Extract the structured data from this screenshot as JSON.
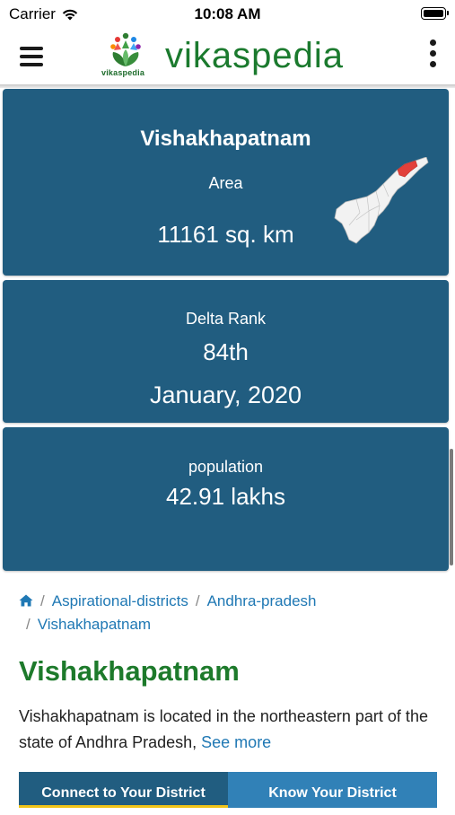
{
  "status_bar": {
    "carrier": "Carrier",
    "time": "10:08 AM"
  },
  "header": {
    "logo_text": "vikaspedia",
    "logo_small_text": "vikaspedia",
    "menu_icon": "hamburger-menu-icon",
    "more_icon": "vertical-ellipsis-icon"
  },
  "stats": {
    "district_name": "Vishakhapatnam",
    "area_label": "Area",
    "area_value": "11161 sq. km",
    "delta_rank_label": "Delta Rank",
    "delta_rank_value": "84th",
    "delta_rank_date": "January, 2020",
    "population_label": "population",
    "population_value": "42.91 lakhs"
  },
  "breadcrumb": {
    "items": [
      "Aspirational-districts",
      "Andhra-pradesh",
      "Vishakhapatnam"
    ]
  },
  "content": {
    "title": "Vishakhapatnam",
    "description": "Vishakhapatnam is located in the northeastern part of the state of Andhra Pradesh,",
    "see_more": "See more"
  },
  "tabs": {
    "connect": "Connect to Your District",
    "know": "Know Your District"
  },
  "colors": {
    "card_bg": "#215d80",
    "brand_green": "#1d7a2b",
    "link_blue": "#1f78b4",
    "tab_active_underline": "#f0c419",
    "map_highlight": "#e2403a"
  }
}
